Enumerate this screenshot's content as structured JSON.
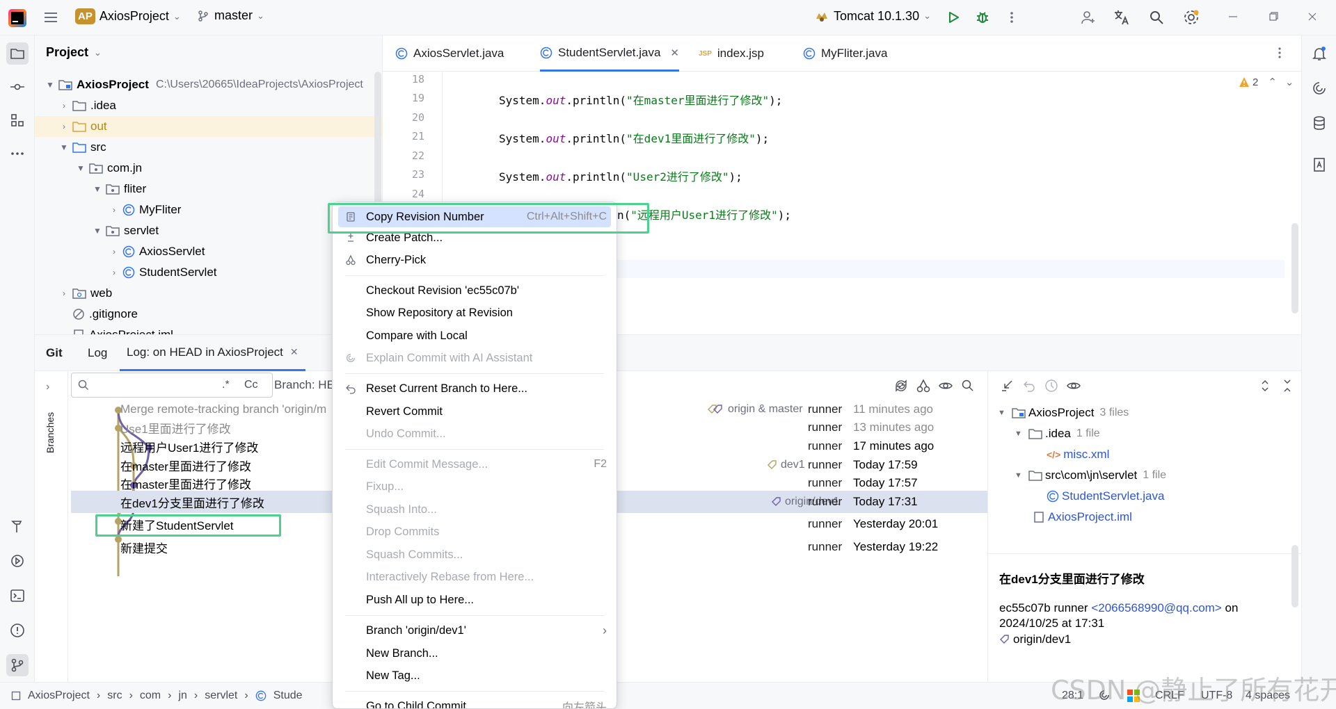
{
  "titlebar": {
    "project_badge": "AP",
    "project_name": "AxiosProject",
    "branch": "master",
    "run_config": "Tomcat 10.1.30"
  },
  "project_panel": {
    "title": "Project",
    "tree": [
      {
        "label": "AxiosProject",
        "path": "C:\\Users\\20665\\IdeaProjects\\AxiosProject"
      },
      {
        "label": ".idea"
      },
      {
        "label": "out"
      },
      {
        "label": "src"
      },
      {
        "label": "com.jn"
      },
      {
        "label": "fliter"
      },
      {
        "label": "MyFliter"
      },
      {
        "label": "servlet"
      },
      {
        "label": "AxiosServlet"
      },
      {
        "label": "StudentServlet"
      },
      {
        "label": "web"
      },
      {
        "label": ".gitignore"
      },
      {
        "label": "AxiosProject.iml"
      }
    ]
  },
  "editor": {
    "tabs": [
      "AxiosServlet.java",
      "StudentServlet.java",
      "index.jsp",
      "MyFliter.java"
    ],
    "warning_count": "2",
    "line_numbers": [
      "18",
      "19",
      "20",
      "21",
      "22",
      "23",
      "24"
    ],
    "code": [
      {
        "pre": "System.",
        "field": "out",
        "call": ".println(",
        "str": "\"在master里面进行了修改\"",
        "post": ");"
      },
      {
        "pre": "System.",
        "field": "out",
        "call": ".println(",
        "str": "\"在dev1里面进行了修改\"",
        "post": ");"
      },
      {
        "pre": "System.",
        "field": "out",
        "call": ".println(",
        "str": "\"User2进行了修改\"",
        "post": ");"
      },
      {
        "pre": "",
        "field": "",
        "call": "n(",
        "str": "\"远程用户User1进行了修改\"",
        "post": ");"
      }
    ]
  },
  "git": {
    "tabs": [
      "Git",
      "Log",
      "Log: on HEAD in AxiosProject"
    ],
    "side_label": "Branches",
    "search_regex": ".*",
    "search_case": "Cc",
    "branch_filter": "Branch: HE",
    "commits": [
      {
        "message": "Merge remote-tracking branch 'origin/m",
        "refs": "origin & master",
        "author": "runner",
        "date": "11 minutes ago",
        "dim": true
      },
      {
        "message": "Use1里面进行了修改",
        "refs": "",
        "author": "runner",
        "date": "13 minutes ago",
        "dim": true
      },
      {
        "message": "远程用户User1进行了修改",
        "refs": "",
        "author": "runner",
        "date": "17 minutes ago",
        "dim": false
      },
      {
        "message": "在master里面进行了修改",
        "refs": "dev1",
        "author": "runner",
        "date": "Today 17:59",
        "dim": false
      },
      {
        "message": "在master里面进行了修改",
        "refs": "",
        "author": "runner",
        "date": "Today 17:57",
        "dim": false
      },
      {
        "message": "在dev1分支里面进行了修改",
        "refs": "origin/dev1",
        "author": "runner",
        "date": "Today 17:31",
        "dim": false
      },
      {
        "message": "新建了StudentServlet",
        "refs": "",
        "author": "runner",
        "date": "Yesterday 20:01",
        "dim": false
      },
      {
        "message": "新建提交",
        "refs": "",
        "author": "runner",
        "date": "Yesterday 19:22",
        "dim": false
      }
    ],
    "details_tree": [
      {
        "label": "AxiosProject",
        "count": "3 files"
      },
      {
        "label": ".idea",
        "count": "1 file"
      },
      {
        "label": "misc.xml",
        "count": ""
      },
      {
        "label": "src\\com\\jn\\servlet",
        "count": "1 file"
      },
      {
        "label": "StudentServlet.java",
        "count": ""
      },
      {
        "label": "AxiosProject.iml",
        "count": ""
      }
    ],
    "detail_message": "在dev1分支里面进行了修改",
    "detail_hash_author": "ec55c07b runner",
    "detail_email": "<2066568990@qq.com>",
    "detail_on": "on",
    "detail_date": "2024/10/25 at 17:31",
    "detail_ref": "origin/dev1"
  },
  "context_menu": {
    "items": [
      {
        "label": "Copy Revision Number",
        "shortcut": "Ctrl+Alt+Shift+C",
        "disabled": false
      },
      {
        "label": "Create Patch...",
        "shortcut": "",
        "disabled": false
      },
      {
        "label": "Cherry-Pick",
        "shortcut": "",
        "disabled": false
      },
      {
        "label": "Checkout Revision 'ec55c07b'",
        "shortcut": "",
        "disabled": false
      },
      {
        "label": "Show Repository at Revision",
        "shortcut": "",
        "disabled": false
      },
      {
        "label": "Compare with Local",
        "shortcut": "",
        "disabled": false
      },
      {
        "label": "Explain Commit with AI Assistant",
        "shortcut": "",
        "disabled": true
      },
      {
        "label": "Reset Current Branch to Here...",
        "shortcut": "",
        "disabled": false
      },
      {
        "label": "Revert Commit",
        "shortcut": "",
        "disabled": false
      },
      {
        "label": "Undo Commit...",
        "shortcut": "",
        "disabled": true
      },
      {
        "label": "Edit Commit Message...",
        "shortcut": "F2",
        "disabled": true
      },
      {
        "label": "Fixup...",
        "shortcut": "",
        "disabled": true
      },
      {
        "label": "Squash Into...",
        "shortcut": "",
        "disabled": true
      },
      {
        "label": "Drop Commits",
        "shortcut": "",
        "disabled": true
      },
      {
        "label": "Squash Commits...",
        "shortcut": "",
        "disabled": true
      },
      {
        "label": "Interactively Rebase from Here...",
        "shortcut": "",
        "disabled": true
      },
      {
        "label": "Push All up to Here...",
        "shortcut": "",
        "disabled": false
      },
      {
        "label": "Branch 'origin/dev1'",
        "shortcut": "",
        "disabled": false
      },
      {
        "label": "New Branch...",
        "shortcut": "",
        "disabled": false
      },
      {
        "label": "New Tag...",
        "shortcut": "",
        "disabled": false
      },
      {
        "label": "Go to Child Commit",
        "shortcut": "向左箭头",
        "disabled": false
      }
    ]
  },
  "statusbar": {
    "breadcrumb": [
      "AxiosProject",
      "src",
      "com",
      "jn",
      "servlet",
      "Stude"
    ],
    "position": "28:1",
    "line_sep": "CRLF",
    "encoding": "UTF-8",
    "indent": "4 spaces"
  },
  "watermark": "CSDN @静止了所有花开",
  "colors": {
    "accent": "#3574f0",
    "highlight_box": "#4cd28f",
    "selected_row": "#dbe1ee",
    "graph": "#b5a366",
    "graph_purple": "#6e5fa8"
  }
}
